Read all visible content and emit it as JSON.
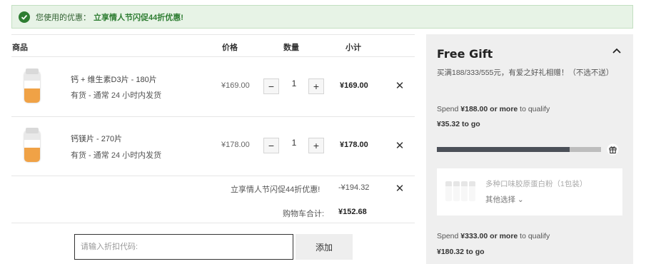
{
  "banner": {
    "label": "您使用的优惠：",
    "offer": "立享情人节闪促44折优惠!"
  },
  "table": {
    "headers": {
      "product": "商品",
      "price": "价格",
      "quantity": "数量",
      "subtotal": "小计"
    }
  },
  "items": [
    {
      "name": "钙 + 维生素D3片 - 180片",
      "stock": "有货 - 通常 24 小时内发货",
      "price": "¥169.00",
      "quantity": "1",
      "subtotal": "¥169.00"
    },
    {
      "name": "钙镁片 - 270片",
      "stock": "有货 - 通常 24 小时内发货",
      "price": "¥178.00",
      "quantity": "1",
      "subtotal": "¥178.00"
    }
  ],
  "promo": {
    "label": "立享情人节闪促44折优惠!",
    "amount": "-¥194.32"
  },
  "total": {
    "label": "购物车合计:",
    "value": "¥152.68"
  },
  "coupon": {
    "placeholder": "请输入折扣代码:",
    "add_label": "添加"
  },
  "gift": {
    "title": "Free Gift",
    "description": "买满188/333/555元，有爱之好礼相赠！（不选不送）",
    "tier1": {
      "prefix": "Spend ",
      "amount": "¥188.00 or more",
      "suffix": " to qualify",
      "to_go": "¥35.32 to go",
      "progress": 0.81
    },
    "card": {
      "name": "多种口味胶原蛋白粉（1包装）",
      "option": "其他选择"
    },
    "tier2": {
      "prefix": "Spend ",
      "amount": "¥333.00 or more",
      "suffix": " to qualify",
      "to_go": "¥180.32 to go"
    }
  },
  "colors": {
    "accent_green": "#2e7d32",
    "banner_bg": "#e7f3e6",
    "progress_fill": "#4b5058",
    "panel_bg": "#efefef"
  },
  "icons": {
    "success": "check-circle-icon",
    "remove": "close-icon",
    "collapse": "chevron-up-icon",
    "gift": "gift-icon",
    "dropdown": "chevron-down-icon"
  }
}
